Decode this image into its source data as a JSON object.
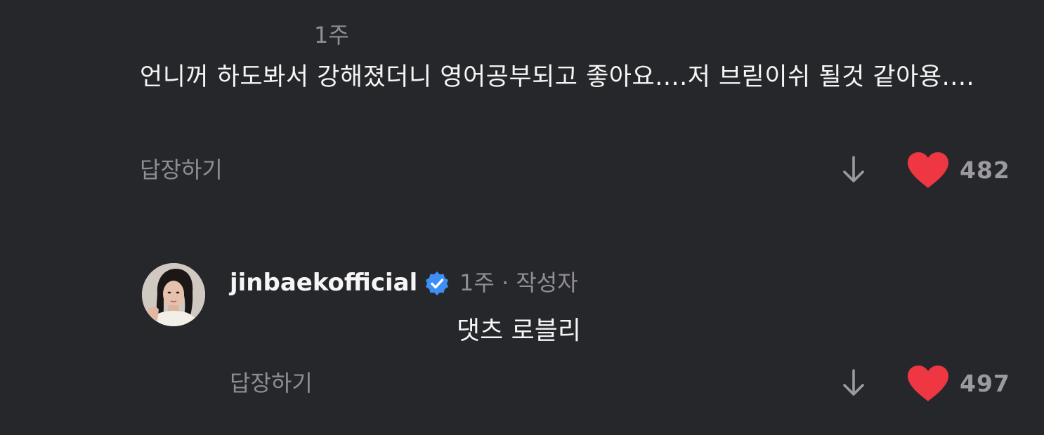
{
  "comments": [
    {
      "time": "1주",
      "text": "언니꺼 하도봐서 강해졌더니 영어공부되고 좋아요....저 브릳이쉬 될것 같아용....",
      "reply_label": "답장하기",
      "like_count": "482",
      "liked": true
    },
    {
      "username": "jinbaekofficial",
      "verified": true,
      "meta": "1주 · 작성자",
      "text": "댓츠 로블리",
      "reply_label": "답장하기",
      "like_count": "497",
      "liked": true
    }
  ],
  "colors": {
    "background": "#26272b",
    "heart": "#ee3743",
    "verified": "#3f8ef5",
    "muted_text": "#8e8e93"
  },
  "icons": {
    "dislike": "arrow-down-icon",
    "like": "heart-icon",
    "verified": "verified-badge-icon"
  }
}
